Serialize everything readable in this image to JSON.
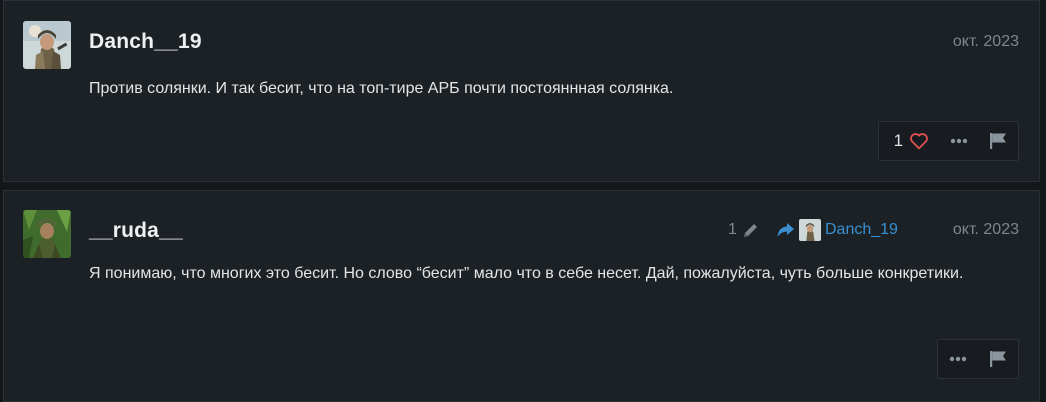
{
  "posts": [
    {
      "username": "Danch__19",
      "date": "окт. 2023",
      "text": "Против солянки. И так бесит, что на топ-тире АРБ почти постояннная солянка.",
      "likes": "1",
      "avatar_icon": "soldier-avatar-icon"
    },
    {
      "username": "__ruda__",
      "date": "окт. 2023",
      "text": "Я понимаю, что многих это бесит. Но слово “бесит” мало что в себе несет. Дай, пожалуйста, чуть больше конкретики.",
      "edit_count": "1",
      "reply_to": "Danch_19",
      "avatar_icon": "jungle-soldier-avatar-icon"
    }
  ],
  "colors": {
    "background": "#14171a",
    "card": "#1c2125",
    "muted": "#7c8790",
    "link": "#3a8fd0",
    "heart": "#e0524f"
  }
}
